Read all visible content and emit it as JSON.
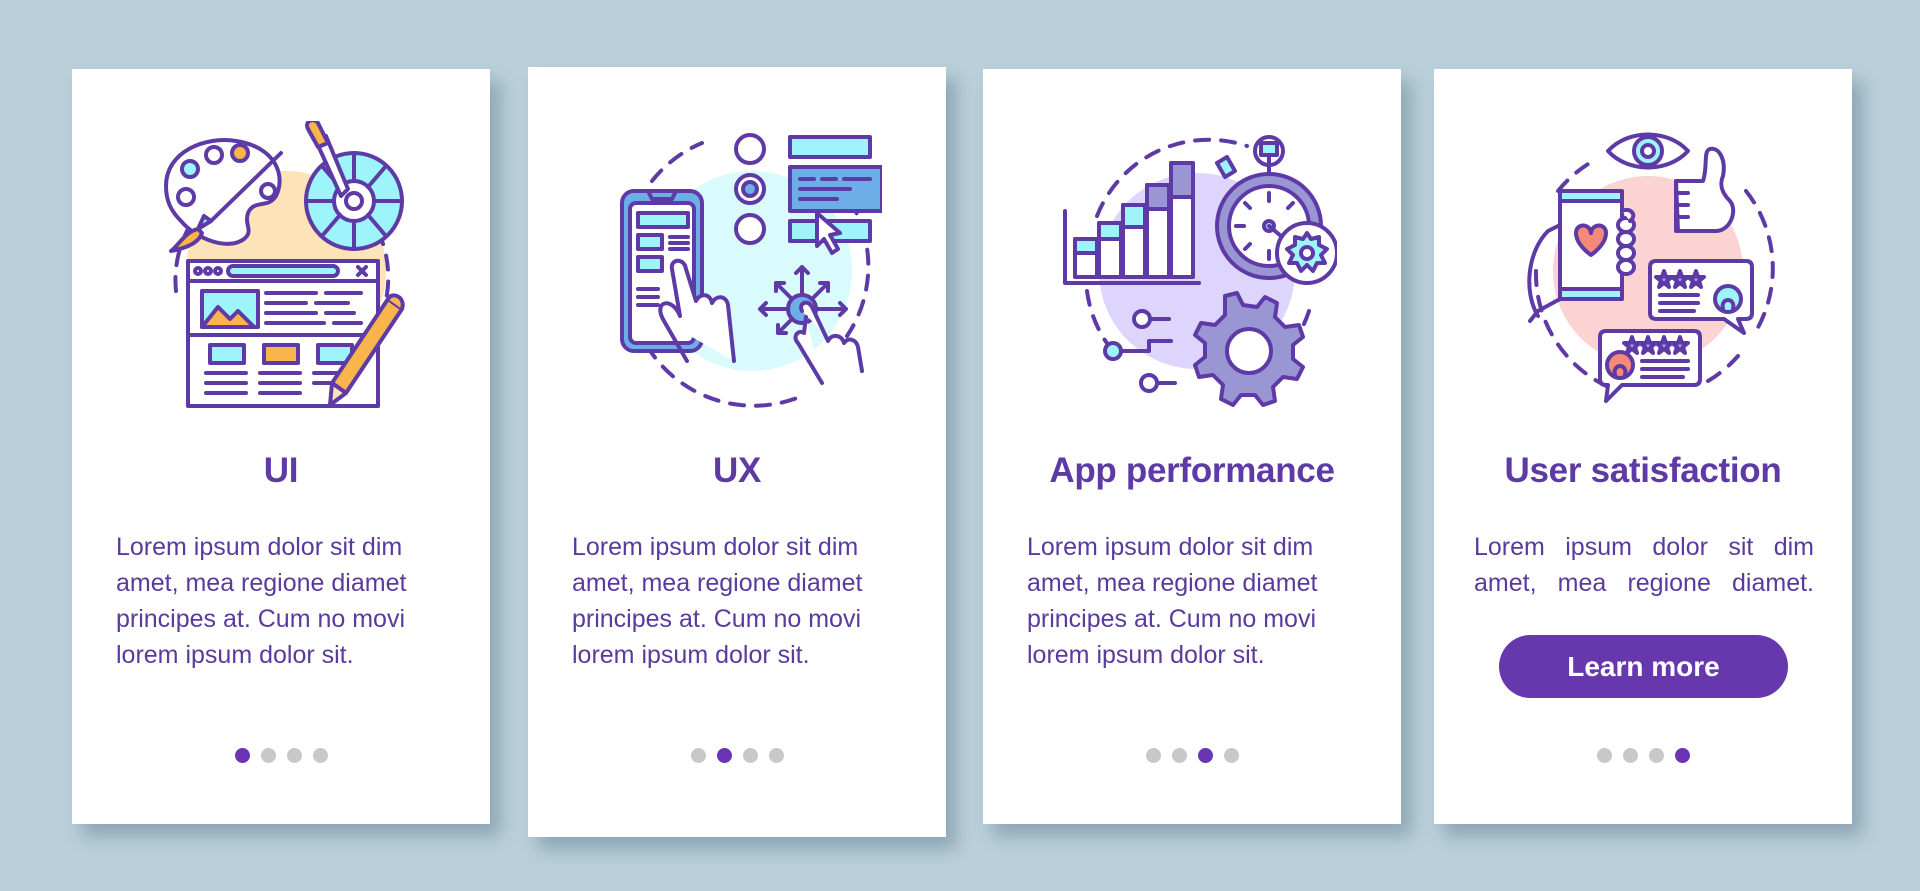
{
  "colors": {
    "background": "#b9cfda",
    "card": "#ffffff",
    "primary": "#6637ad",
    "text": "#5a3a9e",
    "dot_inactive": "#c8c8c8",
    "dot_active": "#6a35b5"
  },
  "screens": [
    {
      "illustration": "ui-design-icon",
      "title": "UI",
      "body": "Lorem ipsum dolor sit dim amet, mea regione diamet principes at. Cum no movi lorem ipsum dolor sit.",
      "page_index": 1,
      "page_count": 4
    },
    {
      "illustration": "ux-design-icon",
      "title": "UX",
      "body": "Lorem ipsum dolor sit dim amet, mea regione diamet principes at. Cum no movi lorem ipsum dolor sit.",
      "page_index": 2,
      "page_count": 4
    },
    {
      "illustration": "app-performance-icon",
      "title": "App performance",
      "body": "Lorem ipsum dolor sit dim amet, mea regione diamet principes at. Cum no movi lorem ipsum dolor sit.",
      "page_index": 3,
      "page_count": 4
    },
    {
      "illustration": "user-satisfaction-icon",
      "title": "User satisfaction",
      "body": "Lorem ipsum dolor sit dim amet, mea regione diamet.",
      "button_label": "Learn more",
      "page_index": 4,
      "page_count": 4
    }
  ]
}
